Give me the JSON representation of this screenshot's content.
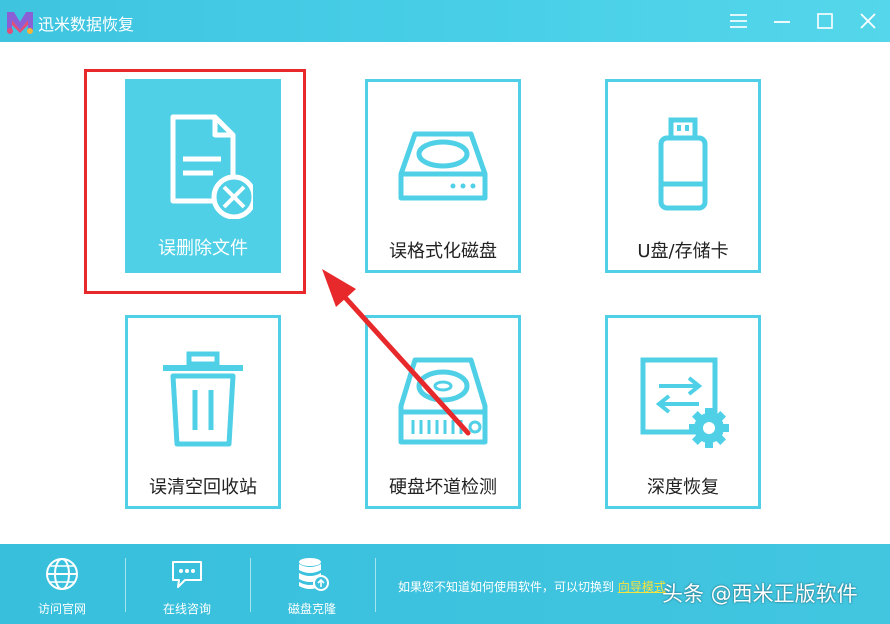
{
  "app": {
    "title": "迅米数据恢复"
  },
  "tiles": [
    {
      "label": "误删除文件",
      "icon": "deleted-file-icon"
    },
    {
      "label": "误格式化磁盘",
      "icon": "format-disk-icon"
    },
    {
      "label": "U盘/存储卡",
      "icon": "usb-drive-icon"
    },
    {
      "label": "误清空回收站",
      "icon": "recycle-bin-icon"
    },
    {
      "label": "硬盘坏道检测",
      "icon": "hard-drive-icon"
    },
    {
      "label": "深度恢复",
      "icon": "deep-recovery-icon"
    }
  ],
  "footer": {
    "items": [
      {
        "label": "访问官网",
        "icon": "globe-icon"
      },
      {
        "label": "在线咨询",
        "icon": "chat-icon"
      },
      {
        "label": "磁盘克隆",
        "icon": "database-clone-icon"
      }
    ],
    "hint_text": "如果您不知道如何使用软件，可以切换到",
    "hint_link": "向导模式"
  },
  "watermark": "头条 @西米正版软件",
  "colors": {
    "accent": "#4fd0e6",
    "highlight": "#e8292b",
    "link": "#f8e33b"
  }
}
